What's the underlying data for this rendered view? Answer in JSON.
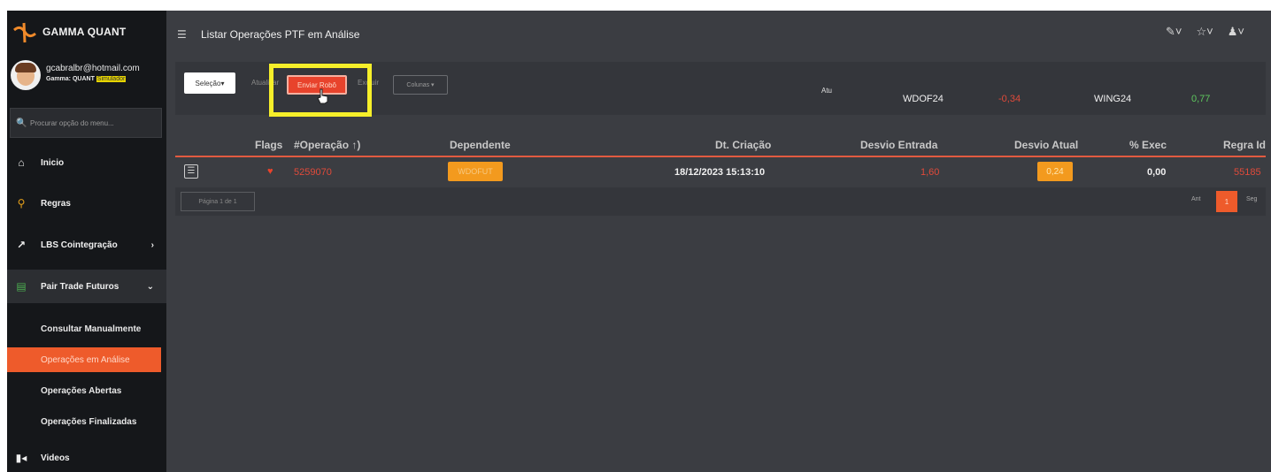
{
  "brand": {
    "name": "GAMMA QUANT"
  },
  "user": {
    "email": "gcabralbr@hotmail.com",
    "plan_label": "Gamma: QUANT",
    "plan_badge": "Simulador"
  },
  "sidebar": {
    "search_placeholder": "Procurar opção do menu...",
    "items": [
      {
        "label": "Inicio",
        "icon": "home-icon"
      },
      {
        "label": "Regras",
        "icon": "search-icon"
      },
      {
        "label": "LBS Cointegração",
        "icon": "chart-icon"
      },
      {
        "label": "Pair Trade Futuros",
        "icon": "money-icon"
      }
    ],
    "subitems": [
      {
        "label": "Consultar Manualmente"
      },
      {
        "label": "Operações em Análise"
      },
      {
        "label": "Operações Abertas"
      },
      {
        "label": "Operações Finalizadas"
      }
    ],
    "videos": {
      "label": "Videos",
      "icon": "video-icon"
    }
  },
  "header": {
    "title": "Listar Operações PTF em Análise"
  },
  "toolbar": {
    "selecao": "Seleção▾",
    "atualizar": "Atualizar",
    "enviar_robo": "Enviar Robô",
    "excluir": "Excluir",
    "colunas": "Colunas ▾",
    "atu": "Atu",
    "ticker1": "WDOF24",
    "ticker1_value": "-0,34",
    "ticker2": "WING24",
    "ticker2_value": "0,77"
  },
  "table": {
    "columns": [
      "Flags",
      "#Operação ↑)",
      "Dependente",
      "Dt. Criação",
      "Desvio Entrada",
      "Desvio Atual",
      "% Exec",
      "Regra Id"
    ],
    "rows": [
      {
        "operacao": "5259070",
        "dependente": "WDOFUT",
        "dt_criacao": "18/12/2023 15:13:10",
        "desvio_entrada": "1,60",
        "desvio_atual": "0,24",
        "exec": "0,00",
        "regra_id": "55185"
      }
    ]
  },
  "pager": {
    "info": "Página 1 de 1",
    "prev": "Ant",
    "current": "1",
    "next": "Seg"
  },
  "colors": {
    "accent": "#ee5b2b",
    "warning": "#f39a1e",
    "negative": "#e04a3a",
    "positive": "#5ec85e",
    "highlight": "#f6ef2a"
  }
}
